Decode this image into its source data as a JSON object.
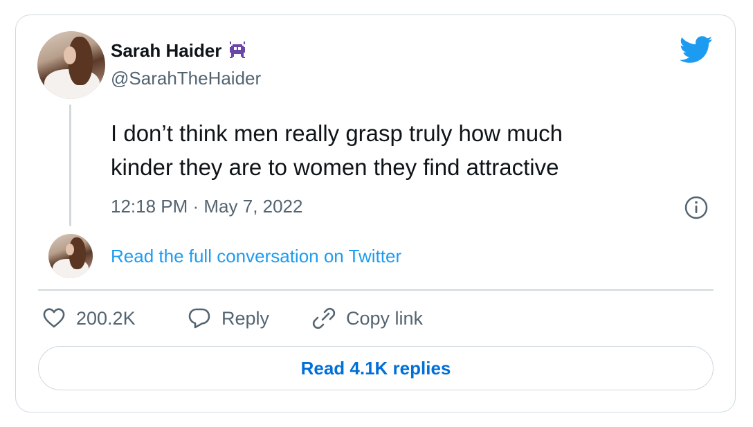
{
  "author": {
    "name": "Sarah Haider",
    "handle": "@SarahTheHaider",
    "emoji_icon": "alien-monster-icon"
  },
  "tweet": {
    "text": "I don’t think men really grasp truly how much\nkinder they are to women they find attractive",
    "timestamp": "12:18 PM · May 7, 2022"
  },
  "conversation_link": "Read the full conversation on Twitter",
  "actions": {
    "like_count": "200.2K",
    "reply_label": "Reply",
    "copy_label": "Copy link"
  },
  "read_replies_label": "Read 4.1K replies",
  "colors": {
    "link_blue": "#1d9bf0",
    "button_blue": "#006fd6",
    "muted_gray": "#536471",
    "border": "#cfd9de"
  }
}
